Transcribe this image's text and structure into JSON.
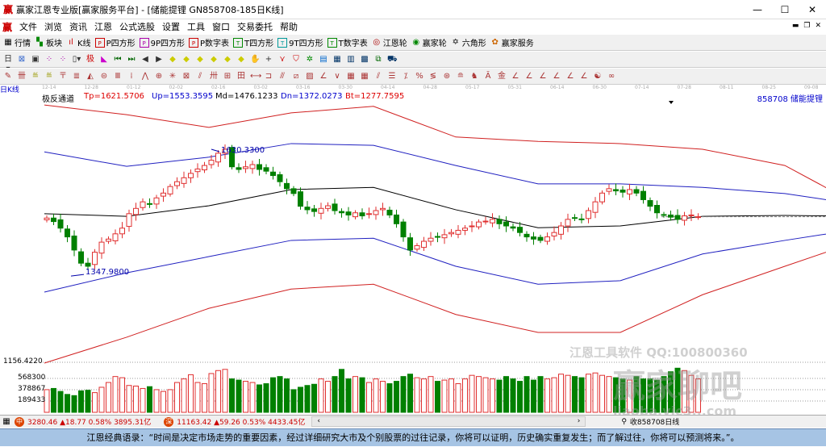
{
  "window": {
    "title": "赢家江恩专业版[赢家服务平台] - [储能提锂  GN858708-185日K线]",
    "controls": [
      "—",
      "☐",
      "✕"
    ]
  },
  "menu": [
    "文件",
    "浏览",
    "资讯",
    "江恩",
    "公式选股",
    "设置",
    "工具",
    "窗口",
    "交易委托",
    "帮助"
  ],
  "toolbar1": [
    "行情",
    "板块",
    "K线",
    "P四方形",
    "9P四方形",
    "P数字表",
    "T四方形",
    "9T四方形",
    "T数字表",
    "江恩轮",
    "赢家轮",
    "六角形",
    "赢家服务"
  ],
  "period_label": "日K线",
  "indicator": {
    "name": "极反通道",
    "tp": "Tp=1621.5706",
    "up": "Up=1553.3595",
    "md": "Md=1476.1233",
    "dn": "Dn=1372.0273",
    "bt": "Bt=1277.7595"
  },
  "stock_label": "858708  储能提锂",
  "dates": [
    "12-14",
    "12-28",
    "01-12",
    "02-02",
    "02-16",
    "03-02",
    "03-16",
    "03-30",
    "04-14",
    "04-28",
    "05-17",
    "05-31",
    "06-14",
    "06-30",
    "07-14",
    "07-28",
    "08-11",
    "08-25",
    "09-08"
  ],
  "annotations": {
    "high": "1630.3300",
    "low": "1347.9800"
  },
  "volume_axis": [
    "1156.4220",
    "568300",
    "378867",
    "189433"
  ],
  "watermark": {
    "line1": "江恩工具软件  QQ:100800360",
    "line2": "赢家聊吧",
    "line3": "liaoba.vic3...com"
  },
  "status": {
    "sh": "3280.46 ▲18.77 0.58% 3895.31亿",
    "sz": "11163.42 ▲59.26 0.53% 4433.45亿",
    "right": "收858708日线"
  },
  "quote": "江恩经典语录：“时间是决定市场走势的重要因素，经过详细研究大市及个别股票的过往记录，你将可以证明，历史确实重复发生；而了解过往，你将可以预测将来。”。",
  "colors": {
    "up": "#e03030",
    "down": "#008000",
    "band_outer": "#d02020",
    "band_inner": "#2020c0",
    "mid": "#000000"
  },
  "chart_data": {
    "type": "candlestick",
    "closes": [
      1473,
      1465,
      1450,
      1430,
      1400,
      1370,
      1363,
      1395,
      1418,
      1425,
      1437,
      1450,
      1483,
      1495,
      1510,
      1505,
      1519,
      1530,
      1545,
      1556,
      1565,
      1575,
      1585,
      1593,
      1605,
      1621,
      1630,
      1590,
      1584,
      1590,
      1595,
      1584,
      1580,
      1570,
      1556,
      1540,
      1529,
      1500,
      1492,
      1488,
      1495,
      1501,
      1490,
      1485,
      1480,
      1485,
      1478,
      1483,
      1490,
      1495,
      1480,
      1460,
      1430,
      1400,
      1410,
      1420,
      1427,
      1430,
      1435,
      1440,
      1445,
      1450,
      1455,
      1464,
      1466,
      1470,
      1460,
      1455,
      1450,
      1440,
      1430,
      1425,
      1422,
      1430,
      1440,
      1455,
      1470,
      1473,
      1470,
      1490,
      1510,
      1530,
      1540,
      1535,
      1532,
      1538,
      1530,
      1515,
      1500,
      1485,
      1480,
      1475,
      1470,
      1478,
      1480,
      1476
    ],
    "volumes": [
      380000,
      400000,
      350000,
      300000,
      280000,
      360000,
      370000,
      330000,
      420000,
      500000,
      600000,
      580000,
      450000,
      440000,
      400000,
      430000,
      380000,
      350000,
      380000,
      500000,
      560000,
      630000,
      500000,
      480000,
      650000,
      700000,
      720000,
      560000,
      540000,
      520000,
      500000,
      460000,
      480000,
      580000,
      600000,
      560000,
      380000,
      420000,
      450000,
      470000,
      560000,
      520000,
      600000,
      720000,
      560000,
      600000,
      580000,
      500000,
      560000,
      520000,
      480000,
      520000,
      600000,
      640000,
      580000,
      560000,
      600000,
      520000,
      540000,
      560000,
      480000,
      560000,
      620000,
      600000,
      580000,
      560000,
      540000,
      600000,
      560000,
      520000,
      600000,
      540000,
      600000,
      560000,
      580000,
      640000,
      620000,
      600000,
      580000,
      640000,
      660000,
      620000,
      600000,
      580000,
      560000,
      540000,
      600000,
      560000,
      560000,
      540000,
      600000,
      680000,
      740000,
      700000,
      620000,
      560000
    ],
    "bands": {
      "sample_every": 12,
      "tp": [
        1731,
        1709,
        1680,
        1713,
        1728,
        1658,
        1648,
        1643,
        1630,
        1593,
        1492
      ],
      "up": [
        1624,
        1591,
        1612,
        1643,
        1639,
        1593,
        1551,
        1551,
        1543,
        1529,
        1501
      ],
      "md": [
        1483,
        1477,
        1501,
        1538,
        1543,
        1492,
        1451,
        1455,
        1477,
        1479,
        1477
      ],
      "dn": [
        1304,
        1348,
        1385,
        1422,
        1427,
        1363,
        1322,
        1330,
        1391,
        1422,
        1451
      ],
      "bt": [
        1142,
        1201,
        1267,
        1311,
        1322,
        1253,
        1212,
        1212,
        1298,
        1363,
        1427
      ]
    },
    "volume_ticks": [
      568300,
      378867,
      189433
    ]
  }
}
